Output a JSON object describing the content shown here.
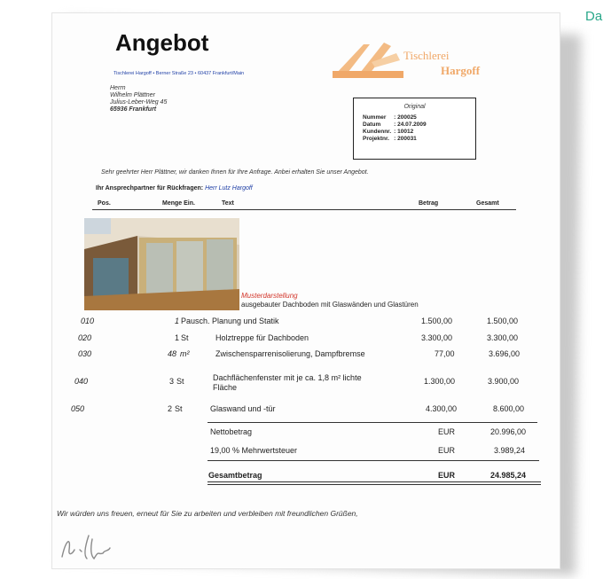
{
  "corner_label": "Da",
  "doc": {
    "title": "Angebot",
    "sender_line": "Tischlerei Hargoff • Berner Straße 23 • 60437 Frankfurt/Main",
    "recipient": [
      "Herrn",
      "Wilhelm Plättner",
      "Julius-Leber-Weg 45",
      "65936 Frankfurt"
    ],
    "logo": {
      "line1": "Tischlerei",
      "line2": "Hargoff"
    },
    "infobox": {
      "caption": "Original",
      "rows": [
        [
          "Nummer",
          ": 200025"
        ],
        [
          "Datum",
          ": 24.07.2009"
        ],
        [
          "Kundennr.",
          ": 10012"
        ],
        [
          "Projektnr.",
          ": 200031"
        ]
      ]
    },
    "greeting": "Sehr geehrter Herr Plättner, wir danken Ihnen für Ihre Anfrage. Anbei erhalten Sie unser Angebot.",
    "contact_label": "Ihr Ansprechpartner für Rückfragen:",
    "contact_name": "Herr Lutz Hargoff",
    "columns": {
      "pos": "Pos.",
      "menge": "Menge Ein.",
      "text": "Text",
      "betrag": "Betrag",
      "gesamt": "Gesamt"
    },
    "musterdarstellung": "Musterdarstellung",
    "description": "ausgebauter Dachboden mit Glaswänden und Glastüren",
    "rows": [
      {
        "pos": "010",
        "qty": "1",
        "unit": "Pausch.",
        "text": "Planung und Statik",
        "betrag": "1.500,00",
        "gesamt": "1.500,00"
      },
      {
        "pos": "020",
        "qty": "1",
        "unit": "St",
        "text": "Holztreppe für Dachboden",
        "betrag": "3.300,00",
        "gesamt": "3.300,00"
      },
      {
        "pos": "030",
        "qty": "48",
        "unit": "m²",
        "text": "Zwischensparrenisolierung, Dampfbremse",
        "betrag": "77,00",
        "gesamt": "3.696,00"
      },
      {
        "pos": "040",
        "qty": "3",
        "unit": "St",
        "text": "Dachflächenfenster mit je ca. 1,8 m² lichte",
        "text2": "Fläche",
        "betrag": "1.300,00",
        "gesamt": "3.900,00"
      },
      {
        "pos": "050",
        "qty": "2",
        "unit": "St",
        "text": "Glaswand und -tür",
        "betrag": "4.300,00",
        "gesamt": "8.600,00"
      }
    ],
    "totals": {
      "netto_label": "Nettobetrag",
      "netto_cur": "EUR",
      "netto": "20.996,00",
      "mwst_label": "19,00 % Mehrwertsteuer",
      "mwst_cur": "EUR",
      "mwst": "3.989,24",
      "gesamt_label": "Gesamtbetrag",
      "gesamt_cur": "EUR",
      "gesamt": "24.985,24"
    },
    "closing": "Wir würden uns freuen, erneut für Sie zu arbeiten und verbleiben mit freundlichen Grüßen,",
    "colors": {
      "accent_text": "#2aa88a",
      "sender_blue": "#1f3fa6",
      "logo_orange": "#f0a868",
      "muster_red": "#d2352a"
    }
  }
}
